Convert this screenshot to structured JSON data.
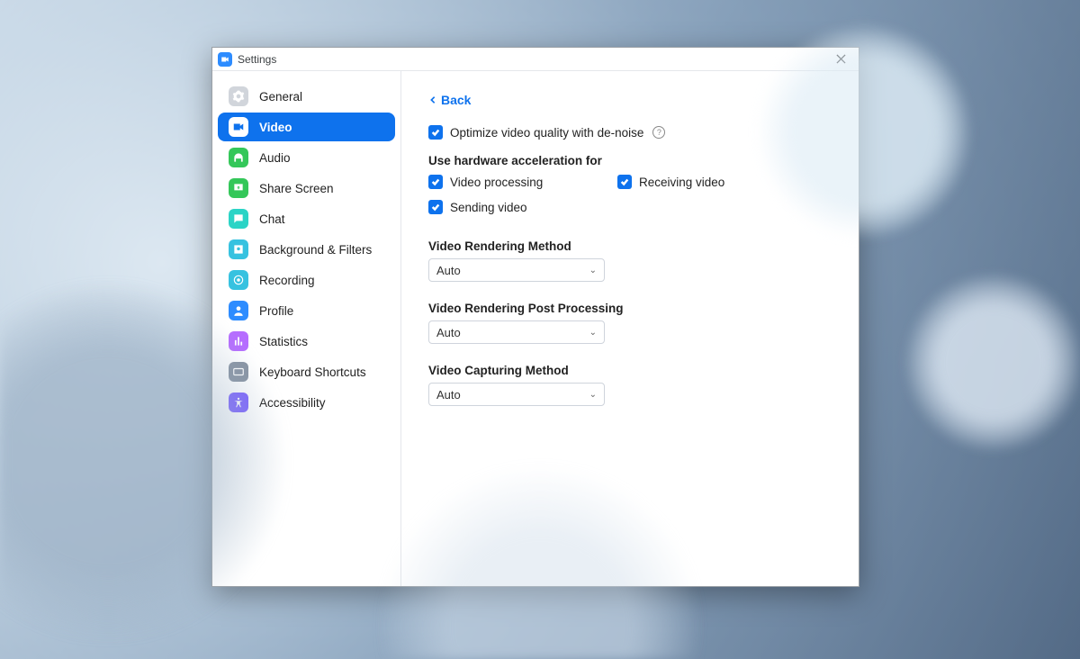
{
  "window": {
    "title": "Settings"
  },
  "sidebar": {
    "items": [
      {
        "label": "General"
      },
      {
        "label": "Video"
      },
      {
        "label": "Audio"
      },
      {
        "label": "Share Screen"
      },
      {
        "label": "Chat"
      },
      {
        "label": "Background & Filters"
      },
      {
        "label": "Recording"
      },
      {
        "label": "Profile"
      },
      {
        "label": "Statistics"
      },
      {
        "label": "Keyboard Shortcuts"
      },
      {
        "label": "Accessibility"
      }
    ]
  },
  "content": {
    "back_label": "Back",
    "optimize_label": "Optimize video quality with de-noise",
    "hw_heading": "Use hardware acceleration for",
    "hw_video_processing": "Video processing",
    "hw_receiving": "Receiving video",
    "hw_sending": "Sending video",
    "rendering_method_label": "Video Rendering Method",
    "rendering_method_value": "Auto",
    "post_processing_label": "Video Rendering Post Processing",
    "post_processing_value": "Auto",
    "capturing_label": "Video Capturing Method",
    "capturing_value": "Auto"
  }
}
